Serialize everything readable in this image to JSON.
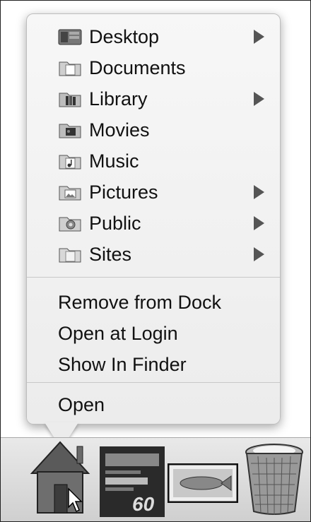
{
  "menu": {
    "folders": [
      {
        "label": "Desktop",
        "icon": "desktop-folder-icon",
        "submenu": true
      },
      {
        "label": "Documents",
        "icon": "documents-folder-icon",
        "submenu": false
      },
      {
        "label": "Library",
        "icon": "library-folder-icon",
        "submenu": true
      },
      {
        "label": "Movies",
        "icon": "movies-folder-icon",
        "submenu": false
      },
      {
        "label": "Music",
        "icon": "music-folder-icon",
        "submenu": false
      },
      {
        "label": "Pictures",
        "icon": "pictures-folder-icon",
        "submenu": true
      },
      {
        "label": "Public",
        "icon": "public-folder-icon",
        "submenu": true
      },
      {
        "label": "Sites",
        "icon": "sites-folder-icon",
        "submenu": true
      }
    ],
    "actions": {
      "remove_from_dock": "Remove from Dock",
      "open_at_login": "Open at Login",
      "show_in_finder": "Show In Finder"
    },
    "open": "Open"
  },
  "dock": {
    "items": [
      {
        "name": "home-folder-icon"
      },
      {
        "name": "book-cover-thumbnail"
      },
      {
        "name": "fish-image-thumbnail"
      },
      {
        "name": "trash-icon"
      }
    ],
    "book_number": "60"
  }
}
